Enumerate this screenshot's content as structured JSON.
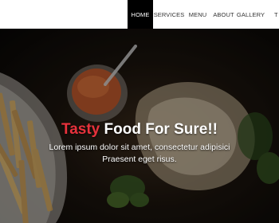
{
  "nav": {
    "items": [
      {
        "label": "HOME",
        "active": true
      },
      {
        "label": "SERVICES",
        "active": false
      },
      {
        "label": "MENU",
        "active": false
      },
      {
        "label": "ABOUT",
        "active": false
      },
      {
        "label": "GALLERY",
        "active": false
      },
      {
        "label": "T",
        "active": false
      }
    ]
  },
  "hero": {
    "headline_accent": "Tasty",
    "headline_rest": " Food For Sure!!",
    "line1": "Lorem ipsum dolor sit amet, consectetur adipisici",
    "line2": "Praesent eget risus."
  },
  "colors": {
    "accent": "#e8323c",
    "nav_active_bg": "#000000",
    "nav_bg": "#ffffff"
  }
}
